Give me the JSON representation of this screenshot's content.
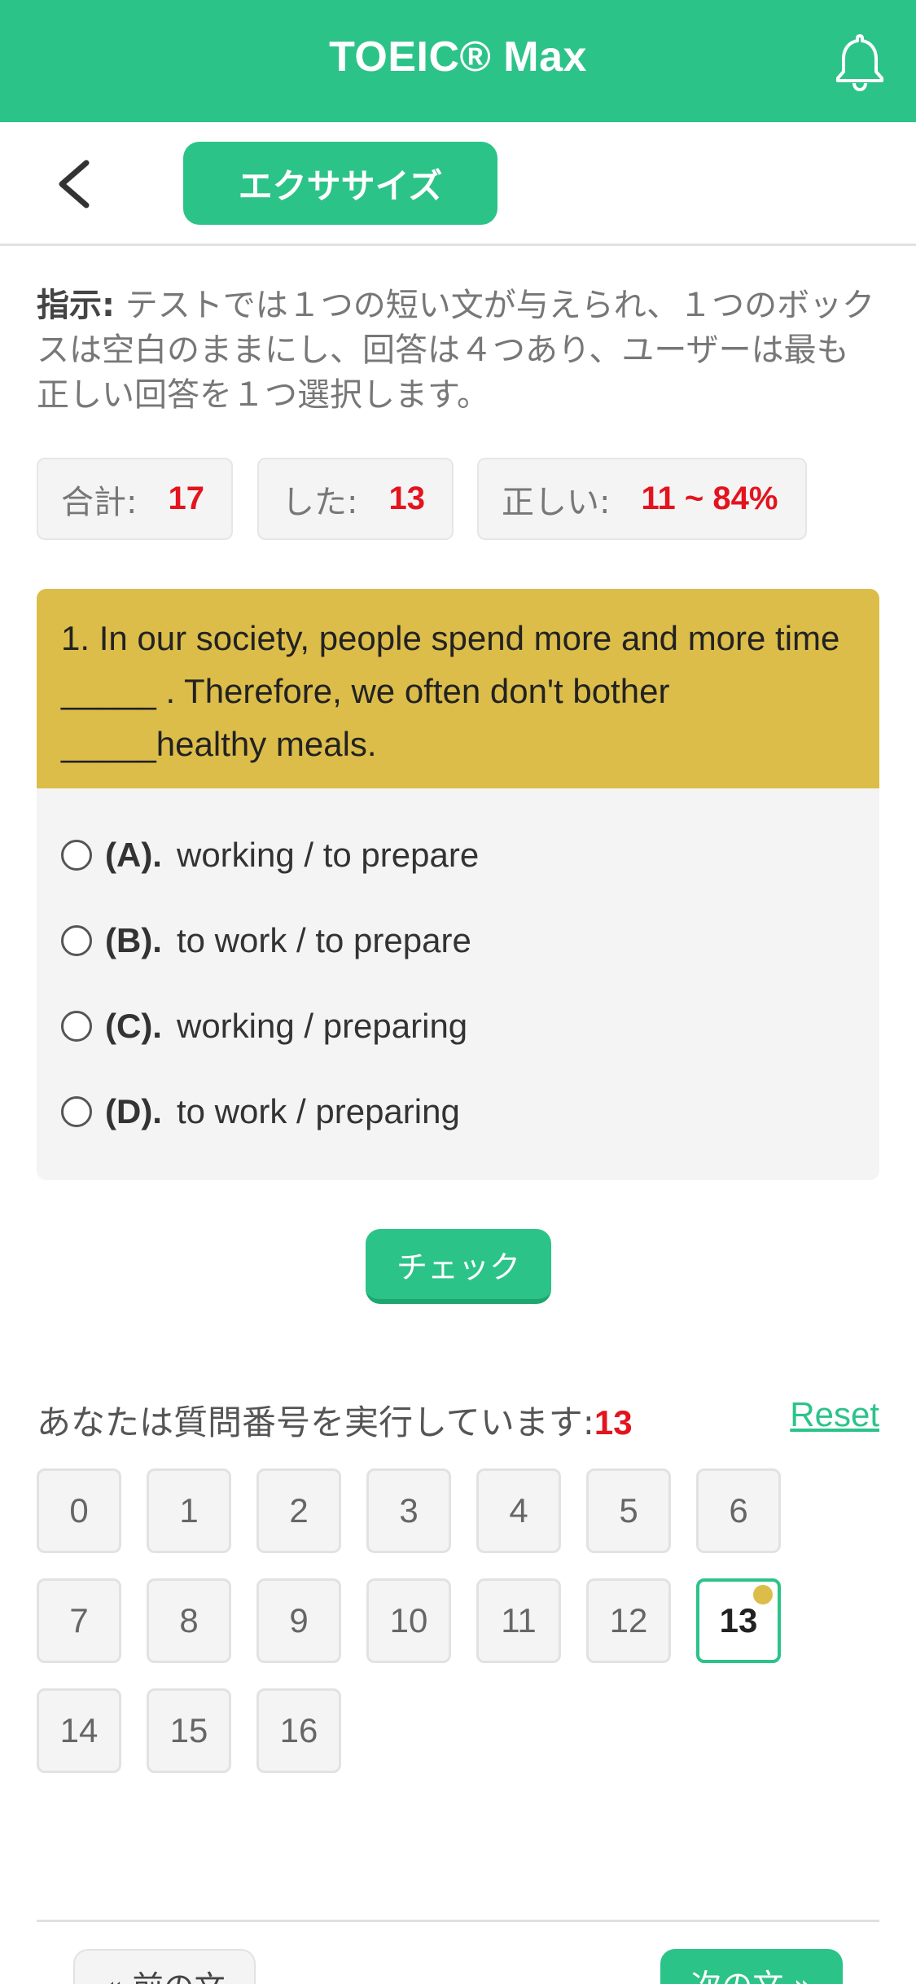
{
  "header": {
    "title": "TOEIC® Max",
    "bell_icon": "bell-icon",
    "color": "#2cc389"
  },
  "subheader": {
    "back_icon": "chevron-left-icon",
    "tab_label": "エクササイズ"
  },
  "instruction": {
    "label": "指示:",
    "text": " テストでは１つの短い文が与えられ、１つのボックスは空白のままにし、回答は４つあり、ユーザーは最も正しい回答を１つ選択します。"
  },
  "stats": {
    "total_label": "合計:",
    "total_value": "17",
    "done_label": "した:",
    "done_value": "13",
    "correct_label": "正しい:",
    "correct_value": "11 ~ 84%"
  },
  "question": {
    "text": "1. In our society, people spend more and more time _____ . Therefore, we often don't bother _____healthy meals.",
    "options": [
      {
        "letter": "(A).",
        "text": "working / to prepare"
      },
      {
        "letter": "(B).",
        "text": "to work / to prepare"
      },
      {
        "letter": "(C).",
        "text": "working / preparing"
      },
      {
        "letter": "(D).",
        "text": "to work / preparing"
      }
    ]
  },
  "check_label": "チェック",
  "progress": {
    "running_label": "あなたは質問番号を実行しています:",
    "current": "13",
    "reset_label": "Reset",
    "numbers": [
      "0",
      "1",
      "2",
      "3",
      "4",
      "5",
      "6",
      "7",
      "8",
      "9",
      "10",
      "11",
      "12",
      "13",
      "14",
      "15",
      "16"
    ]
  },
  "nav": {
    "prev_label": "« 前の文",
    "next_label": "次の文 »"
  }
}
